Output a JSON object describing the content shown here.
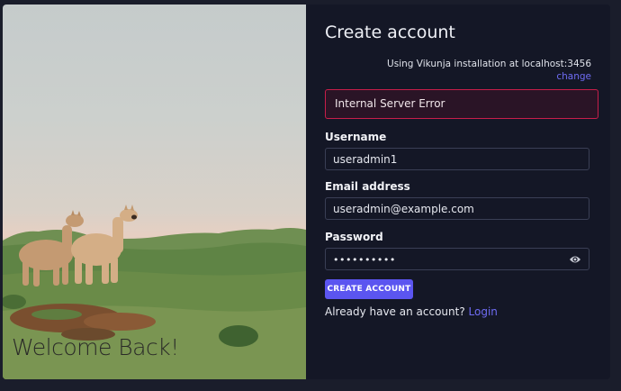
{
  "image_panel": {
    "welcome_text": "Welcome Back!"
  },
  "form": {
    "title": "Create account",
    "installation_text": "Using Vikunja installation at localhost:3456",
    "change_link": "change",
    "error_message": "Internal Server Error",
    "username": {
      "label": "Username",
      "value": "useradmin1"
    },
    "email": {
      "label": "Email address",
      "value": "useradmin@example.com"
    },
    "password": {
      "label": "Password",
      "value": "••••••••••"
    },
    "submit_label": "CREATE ACCOUNT",
    "already_text": "Already have an account?",
    "login_link": "Login"
  },
  "colors": {
    "accent": "#5b55f0",
    "link": "#6f6cf3",
    "error_border": "#c81e4a",
    "card_background": "#141726"
  },
  "icons": {
    "password_toggle": "eye-icon"
  }
}
